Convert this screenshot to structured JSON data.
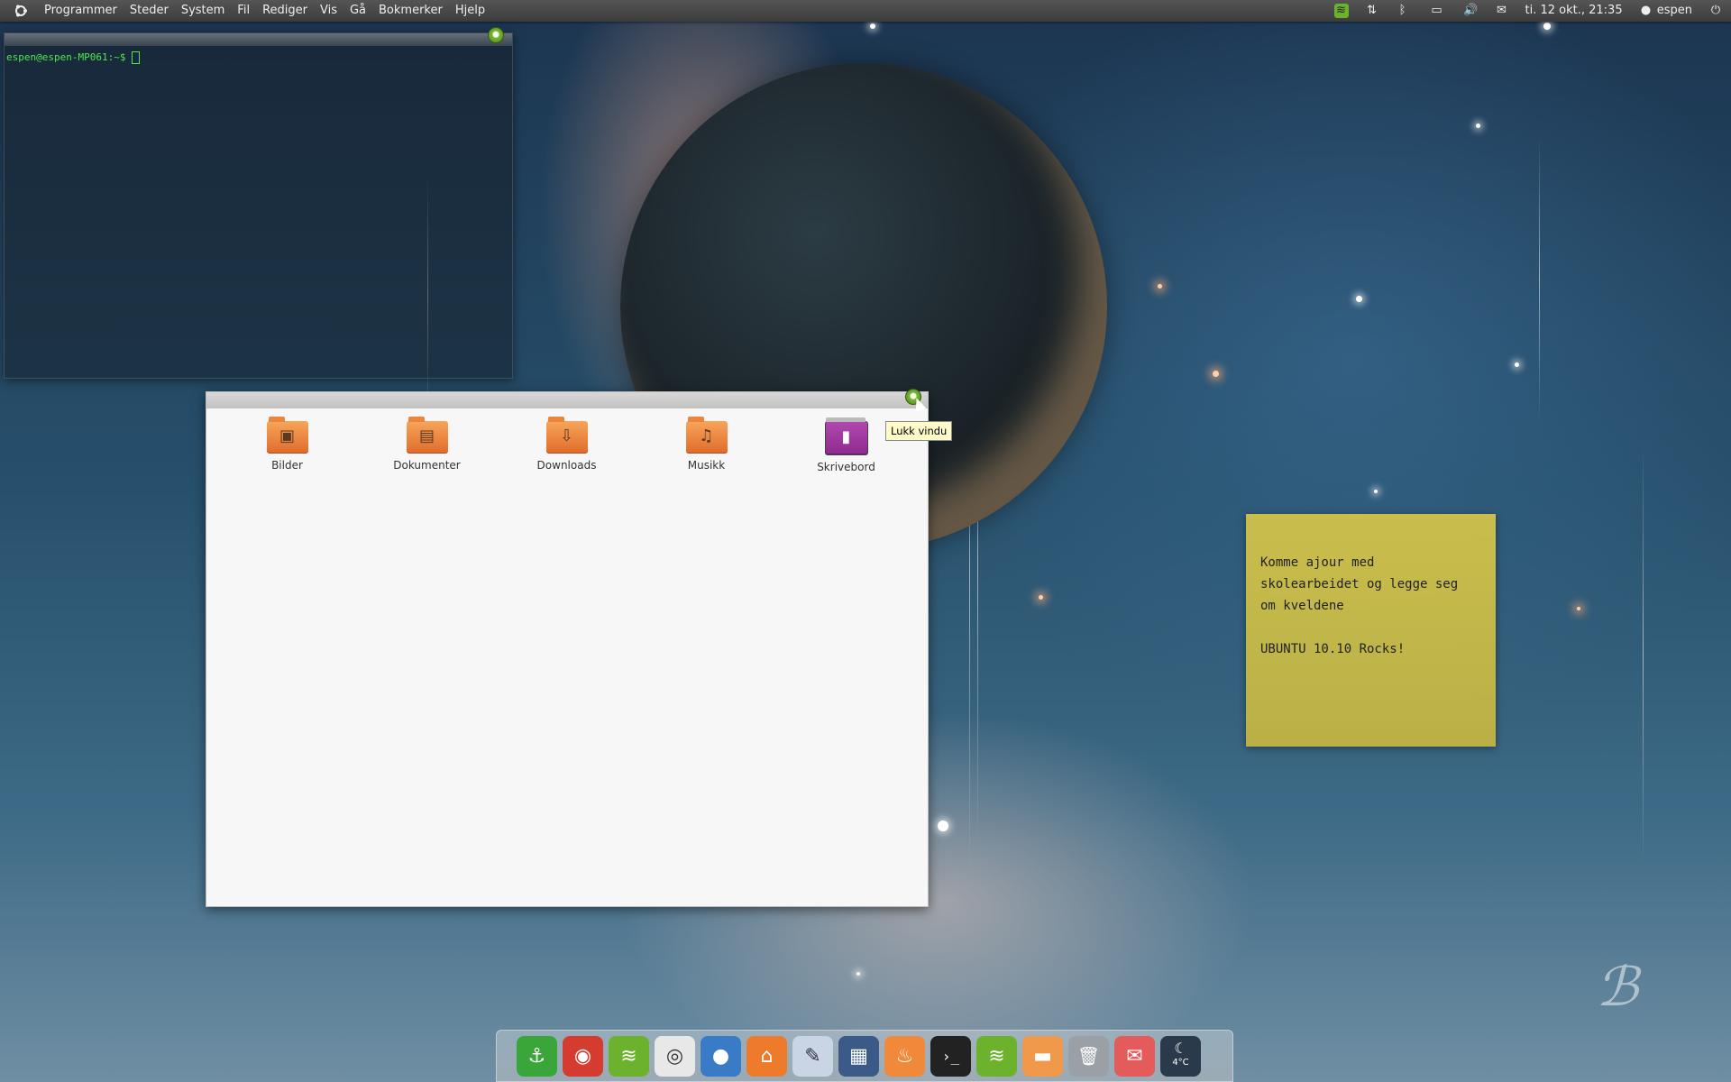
{
  "top_panel": {
    "menu": [
      "Programmer",
      "Steder",
      "System",
      "Fil",
      "Rediger",
      "Vis",
      "Gå",
      "Bokmerker",
      "Hjelp"
    ],
    "clock": "ti. 12 okt., 21:35",
    "user": "espen",
    "tray_icons": [
      "spotify-icon",
      "network-icon",
      "bluetooth-icon",
      "battery-icon",
      "volume-icon",
      "mail-icon"
    ]
  },
  "terminal": {
    "prompt": "espen@espen-MP061:~$ "
  },
  "file_manager": {
    "items": [
      {
        "label": "Bilder",
        "icon": "pictures-folder-icon",
        "glyph": "▣"
      },
      {
        "label": "Dokumenter",
        "icon": "documents-folder-icon",
        "glyph": "▤"
      },
      {
        "label": "Downloads",
        "icon": "downloads-folder-icon",
        "glyph": "⇩"
      },
      {
        "label": "Musikk",
        "icon": "music-folder-icon",
        "glyph": "♫"
      },
      {
        "label": "Skrivebord",
        "icon": "desktop-folder-icon",
        "glyph": "▮"
      }
    ],
    "tooltip": "Lukk vindu"
  },
  "sticky_note": {
    "text": "Komme ajour med\nskolearbeidet og legge seg\nom kveldene\n\nUBUNTU 10.10 Rocks!"
  },
  "dock": {
    "items": [
      {
        "name": "anchor-icon",
        "bg": "#3aa63a",
        "glyph": "⚓"
      },
      {
        "name": "chrome-icon",
        "bg": "#d63b2f",
        "glyph": "◉"
      },
      {
        "name": "spotify-icon",
        "bg": "#6db22d",
        "glyph": "≋"
      },
      {
        "name": "media-player-icon",
        "bg": "#e8e8e8",
        "glyph": "◎"
      },
      {
        "name": "chat-icon",
        "bg": "#3a7bc8",
        "glyph": "●"
      },
      {
        "name": "home-icon",
        "bg": "#ee7a2b",
        "glyph": "⌂"
      },
      {
        "name": "text-editor-icon",
        "bg": "#c9d4e4",
        "glyph": "✎"
      },
      {
        "name": "image-viewer-icon",
        "bg": "#3c5a88",
        "glyph": "▦"
      },
      {
        "name": "burner-icon",
        "bg": "#f08a3a",
        "glyph": "♨"
      },
      {
        "name": "terminal-icon",
        "bg": "#222222",
        "glyph": "›_"
      },
      {
        "name": "spotify-icon-2",
        "bg": "#6db22d",
        "glyph": "≋"
      },
      {
        "name": "folder-icon",
        "bg": "#f0994a",
        "glyph": "▬"
      },
      {
        "name": "trash-icon",
        "bg": "#9aa0a6",
        "glyph": "🗑"
      },
      {
        "name": "gmail-icon",
        "bg": "#e45b5b",
        "glyph": "✉"
      },
      {
        "name": "weather-icon",
        "bg": "#2b3a4a",
        "glyph": "☾"
      }
    ],
    "weather_text": "4°C"
  }
}
